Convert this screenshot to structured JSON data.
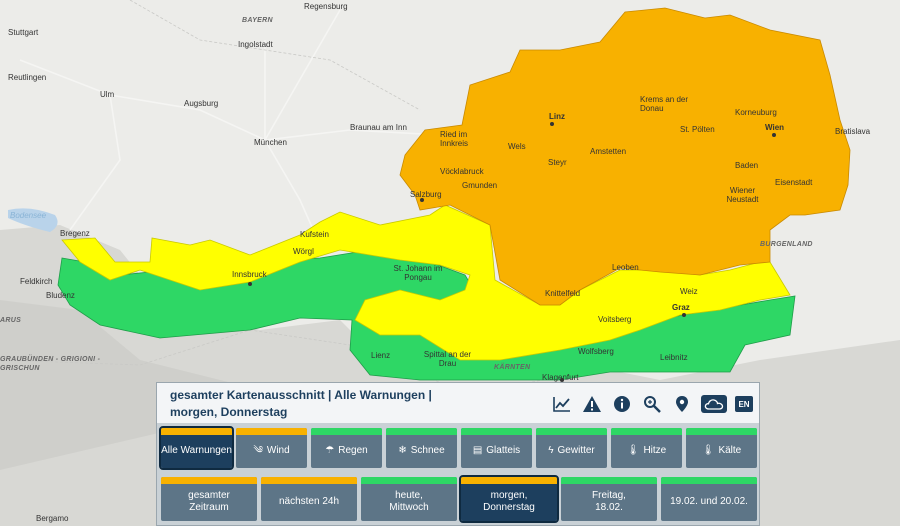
{
  "colors": {
    "warn_orange": "#f8b100",
    "warn_yellow": "#ffff00",
    "warn_green": "#2ed765",
    "panel_dark": "#1d3f5e",
    "button_gray": "#5d7587"
  },
  "map": {
    "cities": [
      {
        "name": "Regensburg"
      },
      {
        "name": "Stuttgart"
      },
      {
        "name": "Ingolstadt"
      },
      {
        "name": "Reutlingen"
      },
      {
        "name": "Ulm"
      },
      {
        "name": "Augsburg"
      },
      {
        "name": "München"
      },
      {
        "name": "Braunau am Inn"
      },
      {
        "name": "Ried im Innkreis"
      },
      {
        "name": "Linz"
      },
      {
        "name": "Wels"
      },
      {
        "name": "Krems an der Donau"
      },
      {
        "name": "Korneuburg"
      },
      {
        "name": "Wien"
      },
      {
        "name": "St. Pölten"
      },
      {
        "name": "Bratislava"
      },
      {
        "name": "Amstetten"
      },
      {
        "name": "Steyr"
      },
      {
        "name": "Vöcklabruck"
      },
      {
        "name": "Gmunden"
      },
      {
        "name": "Baden"
      },
      {
        "name": "Eisenstadt"
      },
      {
        "name": "Wiener Neustadt"
      },
      {
        "name": "Salzburg"
      },
      {
        "name": "Bregenz"
      },
      {
        "name": "Kufstein"
      },
      {
        "name": "Wörgl"
      },
      {
        "name": "Innsbruck"
      },
      {
        "name": "Feldkirch"
      },
      {
        "name": "Bludenz"
      },
      {
        "name": "St. Johann im Pongau"
      },
      {
        "name": "Leoben"
      },
      {
        "name": "Knittelfeld"
      },
      {
        "name": "Weiz"
      },
      {
        "name": "Graz"
      },
      {
        "name": "Voitsberg"
      },
      {
        "name": "Wolfsberg"
      },
      {
        "name": "Leibnitz"
      },
      {
        "name": "Lienz"
      },
      {
        "name": "Spittal an der Drau"
      },
      {
        "name": "Klagenfurt"
      },
      {
        "name": "Bergamo"
      }
    ],
    "regions": [
      "BAYERN",
      "BURGENLAND",
      "KÄRNTEN",
      "GRAUBÜNDEN - GRIGIONI - GRISCHUN",
      "ARUS"
    ],
    "waters": [
      "Bodensee"
    ]
  },
  "panel": {
    "title": "gesamter Kartenausschnitt | Alle Warnungen | morgen, Donnerstag",
    "tools": [
      "chart-icon",
      "warning-icon",
      "info-icon",
      "zoom-icon",
      "location-pin-icon",
      "cloud-icon"
    ],
    "lang_label": "EN",
    "types": [
      {
        "label": "Alle Warnungen",
        "icon": "",
        "level": "#f8b100",
        "active": true
      },
      {
        "label": "Wind",
        "icon": "༄",
        "level": "#f8b100",
        "active": false
      },
      {
        "label": "Regen",
        "icon": "☂",
        "level": "#2ed765",
        "active": false
      },
      {
        "label": "Schnee",
        "icon": "❄",
        "level": "#2ed765",
        "active": false
      },
      {
        "label": "Glatteis",
        "icon": "▤",
        "level": "#2ed765",
        "active": false
      },
      {
        "label": "Gewitter",
        "icon": "ϟ",
        "level": "#2ed765",
        "active": false
      },
      {
        "label": "Hitze",
        "icon": "🌡",
        "level": "#2ed765",
        "active": false
      },
      {
        "label": "Kälte",
        "icon": "🌡",
        "level": "#2ed765",
        "active": false
      }
    ],
    "times": [
      {
        "label": "gesamter Zeitraum",
        "level": "#f8b100",
        "active": false
      },
      {
        "label": "nächsten 24h",
        "level": "#f8b100",
        "active": false
      },
      {
        "label": "heute, Mittwoch",
        "level": "#2ed765",
        "active": false
      },
      {
        "label": "morgen, Donnerstag",
        "level": "#f8b100",
        "active": true
      },
      {
        "label": "Freitag, 18.02.",
        "level": "#2ed765",
        "active": false
      },
      {
        "label": "19.02. und 20.02.",
        "level": "#2ed765",
        "active": false
      }
    ]
  }
}
